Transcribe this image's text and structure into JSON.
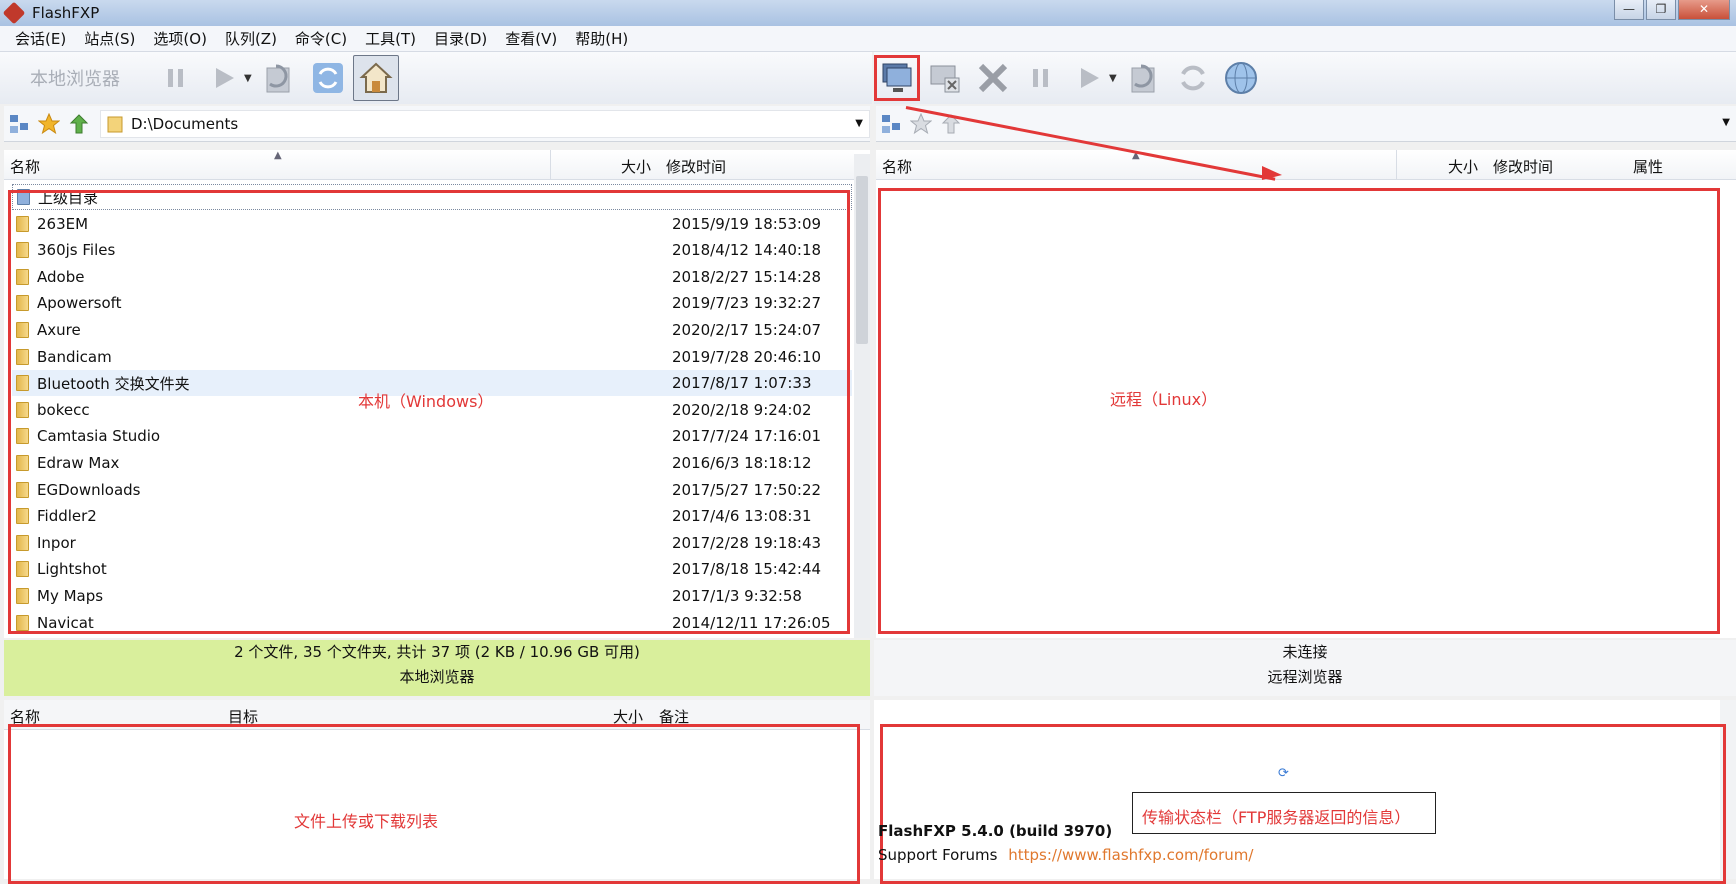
{
  "window": {
    "title": "FlashFXP",
    "min_label": "—",
    "max_label": "❐",
    "close_label": "✕"
  },
  "menu": [
    "会话(E)",
    "站点(S)",
    "选项(O)",
    "队列(Z)",
    "命令(C)",
    "工具(T)",
    "目录(D)",
    "查看(V)",
    "帮助(H)"
  ],
  "local": {
    "toolbar_label": "本地浏览器",
    "path": "D:\\Documents",
    "columns": {
      "name": "名称",
      "size": "大小",
      "mtime": "修改时间"
    },
    "rows": [
      {
        "name": "上级目录",
        "mtime": ""
      },
      {
        "name": "263EM",
        "mtime": "2015/9/19 18:53:09"
      },
      {
        "name": "360js Files",
        "mtime": "2018/4/12 14:40:18"
      },
      {
        "name": "Adobe",
        "mtime": "2018/2/27 15:14:28"
      },
      {
        "name": "Apowersoft",
        "mtime": "2019/7/23 19:32:27"
      },
      {
        "name": "Axure",
        "mtime": "2020/2/17 15:24:07"
      },
      {
        "name": "Bandicam",
        "mtime": "2019/7/28 20:46:10"
      },
      {
        "name": "Bluetooth 交换文件夹",
        "mtime": "2017/8/17 1:07:33"
      },
      {
        "name": "bokecc",
        "mtime": "2020/2/18 9:24:02"
      },
      {
        "name": "Camtasia Studio",
        "mtime": "2017/7/24 17:16:01"
      },
      {
        "name": "Edraw Max",
        "mtime": "2016/6/3 18:18:12"
      },
      {
        "name": "EGDownloads",
        "mtime": "2017/5/27 17:50:22"
      },
      {
        "name": "Fiddler2",
        "mtime": "2017/4/6 13:08:31"
      },
      {
        "name": "Inpor",
        "mtime": "2017/2/28 19:18:43"
      },
      {
        "name": "Lightshot",
        "mtime": "2017/8/18 15:42:44"
      },
      {
        "name": "My Maps",
        "mtime": "2017/1/3 9:32:58"
      },
      {
        "name": "Navicat",
        "mtime": "2014/12/11 17:26:05"
      }
    ],
    "annotation": "本机（Windows）",
    "status_summary": "2 个文件, 35 个文件夹, 共计 37 项 (2 KB / 10.96 GB 可用)",
    "status_title": "本地浏览器"
  },
  "remote": {
    "columns": {
      "name": "名称",
      "size": "大小",
      "mtime": "修改时间",
      "attr": "属性"
    },
    "annotation": "远程（Linux）",
    "status_conn": "未连接",
    "status_title": "远程浏览器"
  },
  "queue": {
    "columns": {
      "name": "名称",
      "target": "目标",
      "size": "大小",
      "note": "备注"
    },
    "annotation": "文件上传或下载列表"
  },
  "log": {
    "annotation": "传输状态栏（FTP服务器返回的信息）",
    "version": "FlashFXP 5.4.0 (build 3970)",
    "support_label": "Support Forums",
    "support_url": "https://www.flashfxp.com/forum/"
  },
  "colors": {
    "annotation_red": "#e23838",
    "status_green": "#d9ef9c",
    "link_orange": "#e0782e"
  }
}
